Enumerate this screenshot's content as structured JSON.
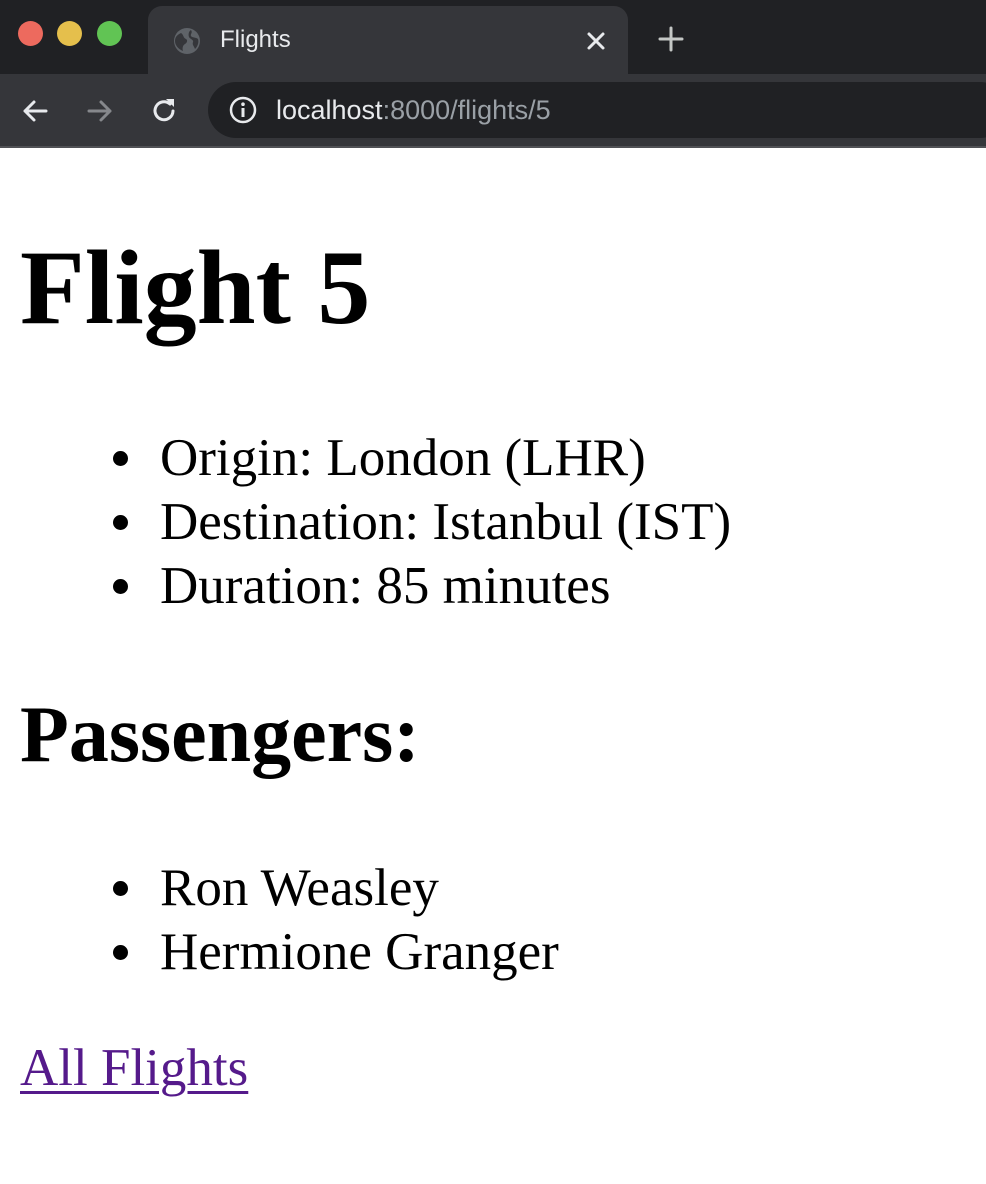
{
  "browser": {
    "tab": {
      "title": "Flights",
      "favicon": "globe-icon"
    },
    "omnibox": {
      "host": "localhost",
      "path": ":8000/flights/5"
    },
    "colors": {
      "close": "#ed6a5e",
      "minimize": "#e5bf4c",
      "zoom": "#61c454"
    }
  },
  "page": {
    "title": "Flight 5",
    "details": [
      "Origin: London (LHR)",
      "Destination: Istanbul (IST)",
      "Duration: 85 minutes"
    ],
    "passengers_heading": "Passengers:",
    "passengers": [
      "Ron Weasley",
      "Hermione Granger"
    ],
    "back_link": "All Flights",
    "link_color": "#551a8b"
  }
}
